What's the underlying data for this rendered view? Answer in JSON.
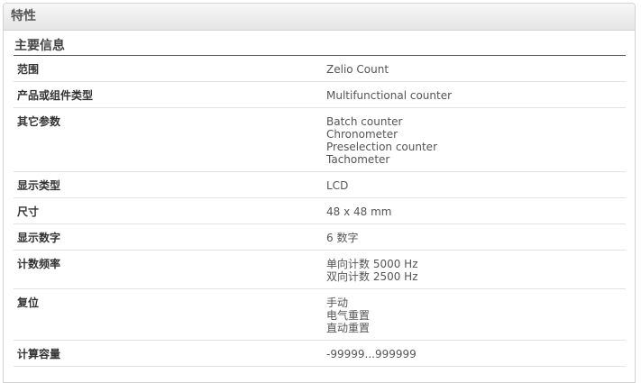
{
  "panel": {
    "title": "特性"
  },
  "section": {
    "title": "主要信息"
  },
  "rows": [
    {
      "label": "范围",
      "values": [
        "Zelio Count"
      ]
    },
    {
      "label": "产品或组件类型",
      "values": [
        "Multifunctional counter"
      ]
    },
    {
      "label": "其它参数",
      "values": [
        "Batch counter",
        "Chronometer",
        "Preselection counter",
        "Tachometer"
      ]
    },
    {
      "label": "显示类型",
      "values": [
        "LCD"
      ]
    },
    {
      "label": "尺寸",
      "values": [
        "48 x 48 mm"
      ]
    },
    {
      "label": "显示数字",
      "values": [
        "6 数字"
      ]
    },
    {
      "label": "计数频率",
      "values": [
        "单向计数 5000 Hz",
        "双向计数 2500 Hz"
      ]
    },
    {
      "label": "复位",
      "values": [
        "手动",
        "电气重置",
        "直动重置"
      ]
    },
    {
      "label": "计算容量",
      "values": [
        "-99999...999999"
      ]
    }
  ]
}
